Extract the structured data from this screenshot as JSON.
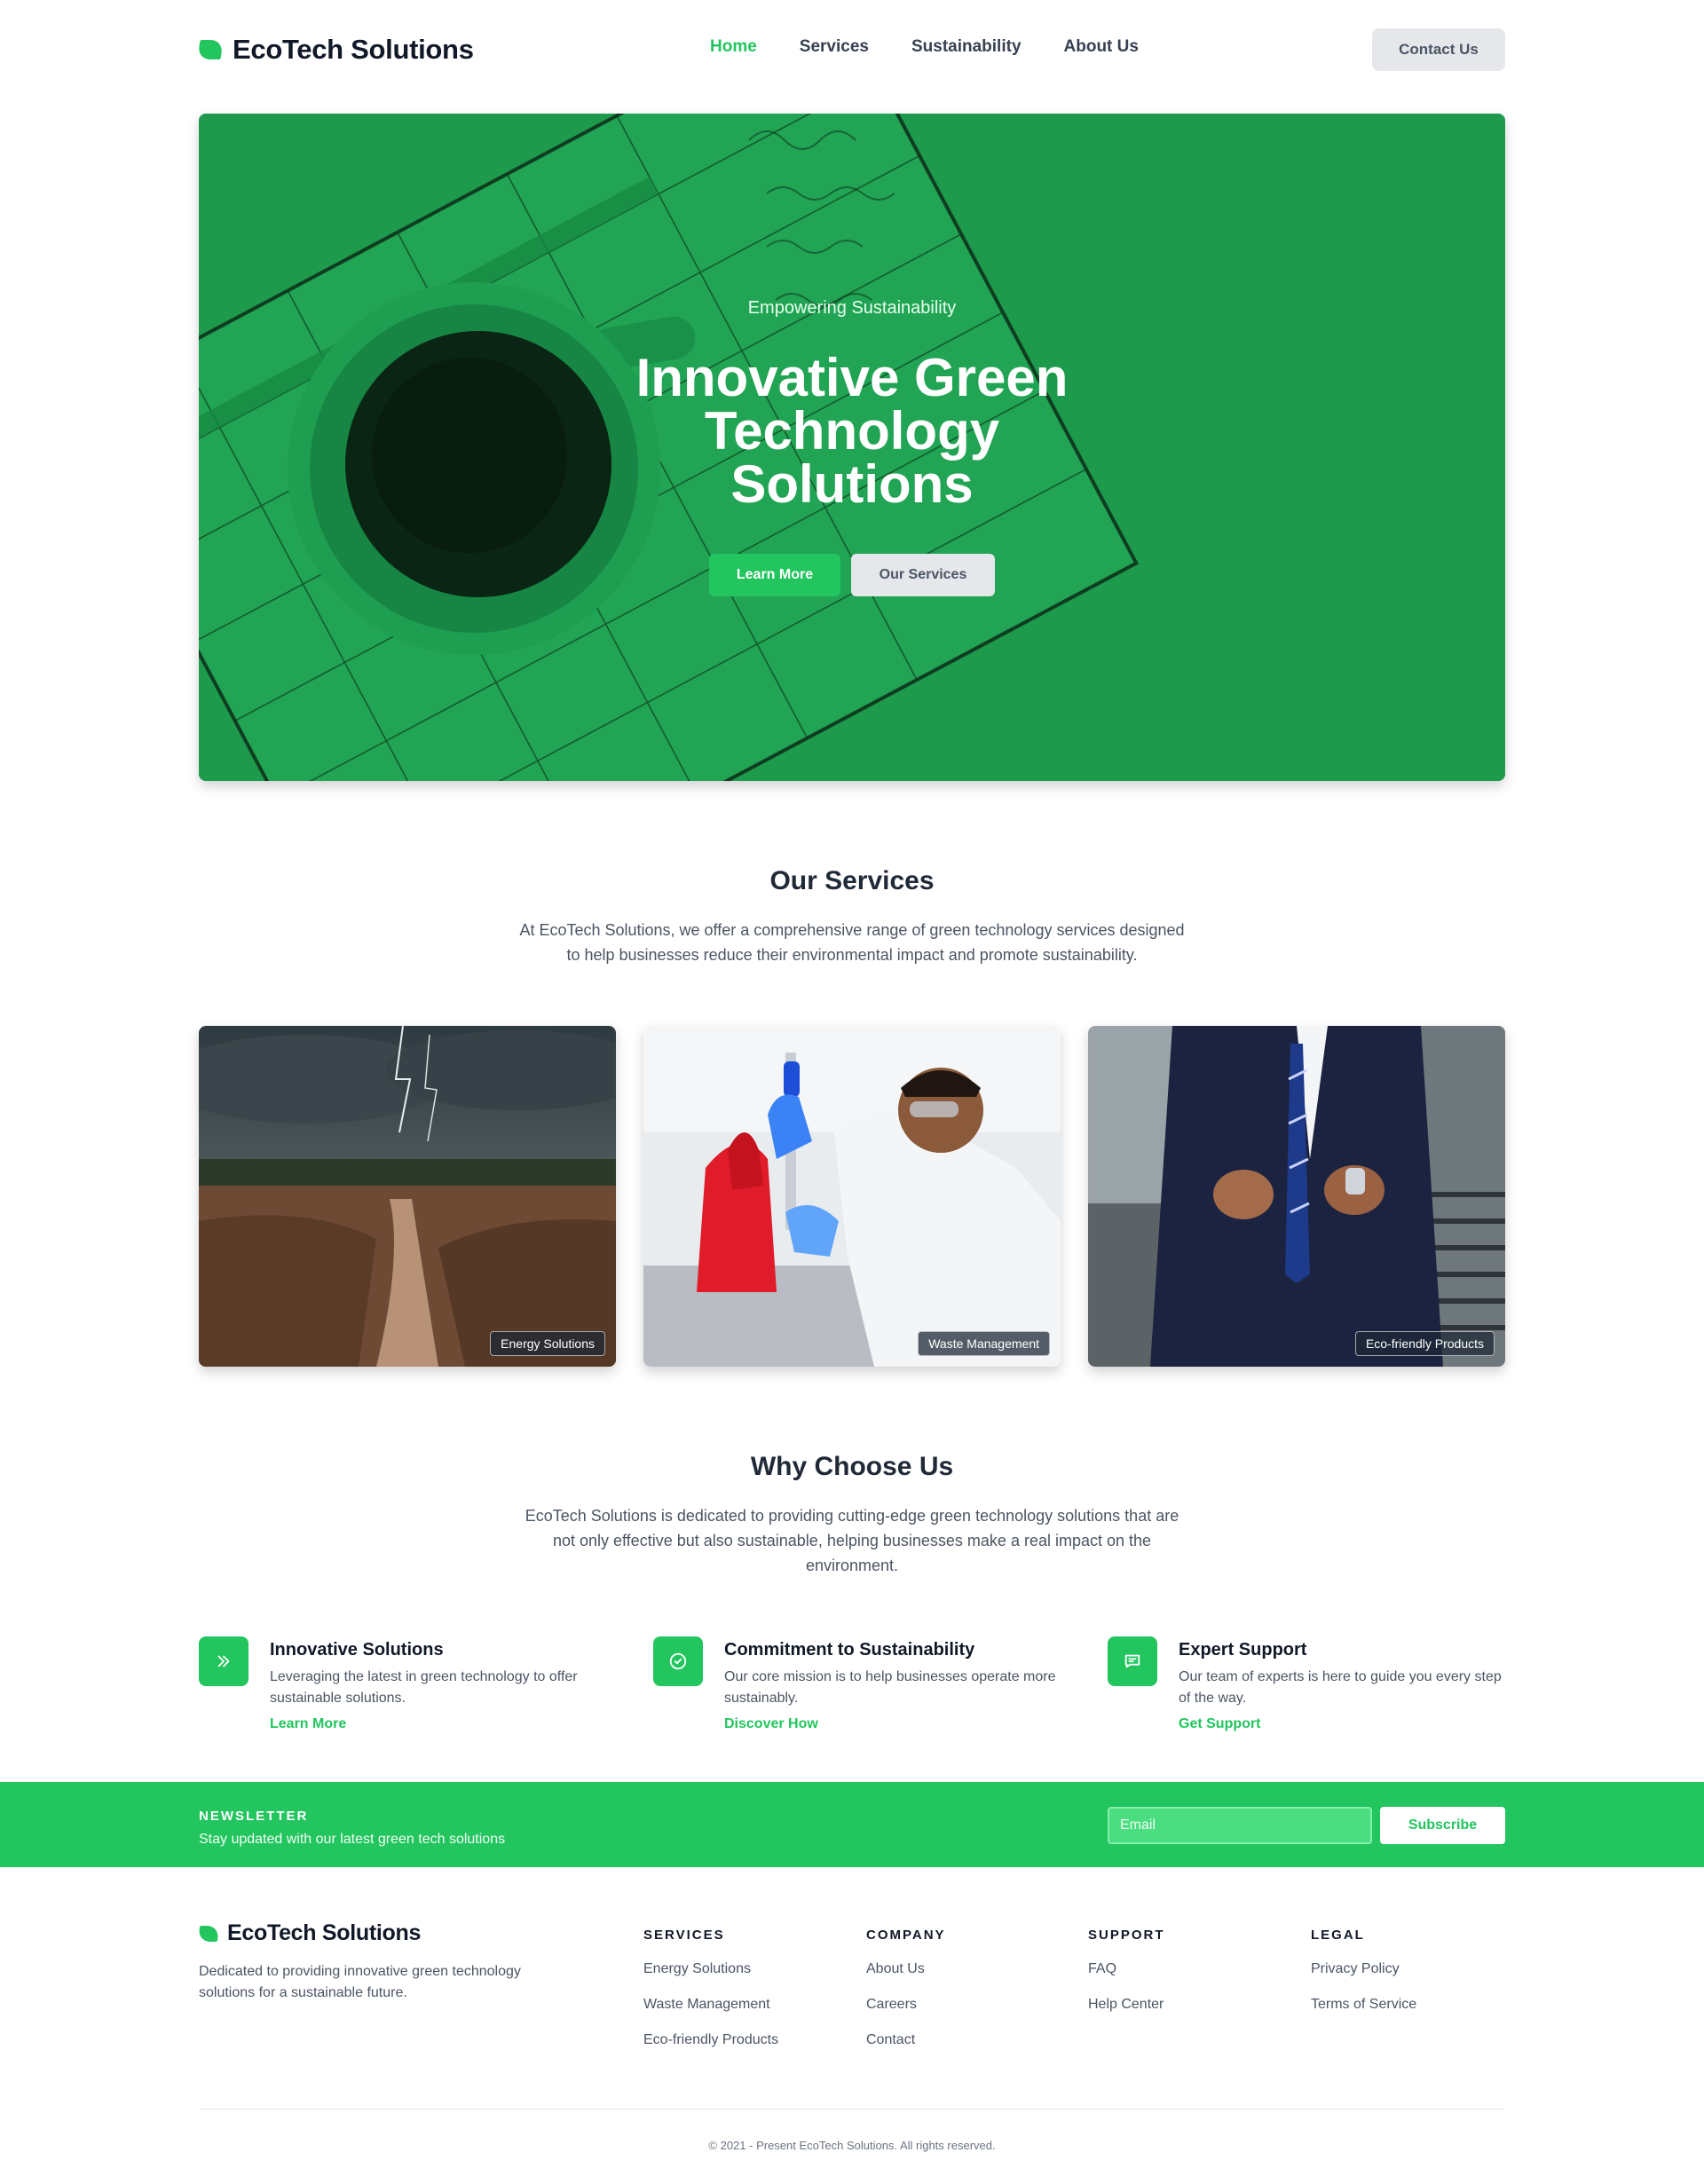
{
  "header": {
    "brand": "EcoTech Solutions",
    "nav": [
      {
        "label": "Home",
        "active": true
      },
      {
        "label": "Services",
        "active": false
      },
      {
        "label": "Sustainability",
        "active": false
      },
      {
        "label": "About Us",
        "active": false
      }
    ],
    "contact_label": "Contact Us"
  },
  "hero": {
    "eyebrow": "Empowering Sustainability",
    "title": "Innovative Green Technology Solutions",
    "primary_button": "Learn More",
    "secondary_button": "Our Services"
  },
  "services": {
    "title": "Our Services",
    "description": "At EcoTech Solutions, we offer a comprehensive range of green technology services designed to help businesses reduce their environmental impact and promote sustainability.",
    "cards": [
      {
        "label": "Energy Solutions"
      },
      {
        "label": "Waste Management"
      },
      {
        "label": "Eco-friendly Products"
      }
    ]
  },
  "why": {
    "title": "Why Choose Us",
    "description": "EcoTech Solutions is dedicated to providing cutting-edge green technology solutions that are not only effective but also sustainable, helping businesses make a real impact on the environment.",
    "features": [
      {
        "icon": "chevrons-right-icon",
        "title": "Innovative Solutions",
        "description": "Leveraging the latest in green technology to offer sustainable solutions.",
        "link": "Learn More"
      },
      {
        "icon": "check-circle-icon",
        "title": "Commitment to Sustainability",
        "description": "Our core mission is to help businesses operate more sustainably.",
        "link": "Discover How"
      },
      {
        "icon": "chat-icon",
        "title": "Expert Support",
        "description": "Our team of experts is here to guide you every step of the way.",
        "link": "Get Support"
      }
    ]
  },
  "newsletter": {
    "heading": "NEWSLETTER",
    "subtext": "Stay updated with our latest green tech solutions",
    "email_placeholder": "Email",
    "button": "Subscribe"
  },
  "footer": {
    "brand": "EcoTech Solutions",
    "about": "Dedicated to providing innovative green technology solutions for a sustainable future.",
    "columns": [
      {
        "heading": "SERVICES",
        "links": [
          "Energy Solutions",
          "Waste Management",
          "Eco-friendly Products"
        ]
      },
      {
        "heading": "COMPANY",
        "links": [
          "About Us",
          "Careers",
          "Contact"
        ]
      },
      {
        "heading": "SUPPORT",
        "links": [
          "FAQ",
          "Help Center"
        ]
      },
      {
        "heading": "LEGAL",
        "links": [
          "Privacy Policy",
          "Terms of Service"
        ]
      }
    ],
    "copyright": "© 2021 - Present EcoTech Solutions. All rights reserved."
  },
  "colors": {
    "accent": "#22c55e",
    "hero_overlay": "#1d9a4c",
    "text_dark": "#1f2937"
  }
}
